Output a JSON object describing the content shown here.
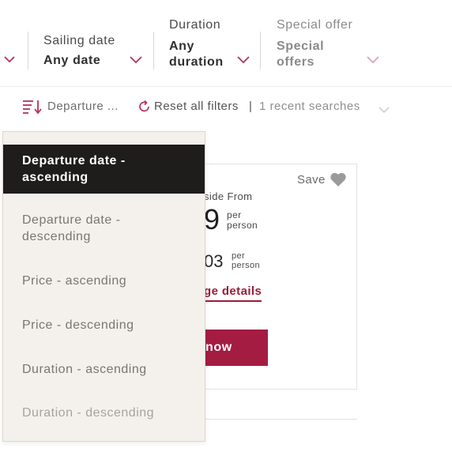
{
  "filters": [
    {
      "label": "Sailing date",
      "value": "Any date"
    },
    {
      "label": "Duration",
      "value_line1": "Any",
      "value_line2": "duration"
    },
    {
      "label": "Special offer",
      "value_line1": "Special",
      "value_line2": "offers"
    }
  ],
  "sort_bar": {
    "sort_label": "Departure ...",
    "reset_label": "Reset all filters",
    "separator": "|",
    "recent_label": "1 recent searches"
  },
  "card": {
    "save_label": "Save",
    "inside_from": "side From",
    "price_big": "9",
    "per_line1": "per",
    "per_line2": "person",
    "price_small": "03",
    "per_small_line1": "per",
    "per_small_line2": "person",
    "details_link": "ge details",
    "book_label": "now"
  },
  "sort_options": [
    {
      "line1": "Departure date -",
      "line2": "ascending",
      "state": "active"
    },
    {
      "line1": "Departure date -",
      "line2": "descending",
      "state": "normal"
    },
    {
      "line1": "Price - ascending",
      "line2": "",
      "state": "normal"
    },
    {
      "line1": "Price - descending",
      "line2": "",
      "state": "normal"
    },
    {
      "line1": "Duration - ascending",
      "line2": "",
      "state": "normal"
    },
    {
      "line1": "Duration - descending",
      "line2": "",
      "state": "dim"
    }
  ],
  "colors": {
    "accent": "#a51c42",
    "link": "#9b1c3a",
    "chevron": "#b3325a",
    "active_option_bg": "#1f1d1b",
    "dropdown_bg": "#f4f1ec"
  },
  "icons": [
    "chevron-down-icon",
    "sort-icon",
    "reset-icon",
    "heart-icon"
  ]
}
